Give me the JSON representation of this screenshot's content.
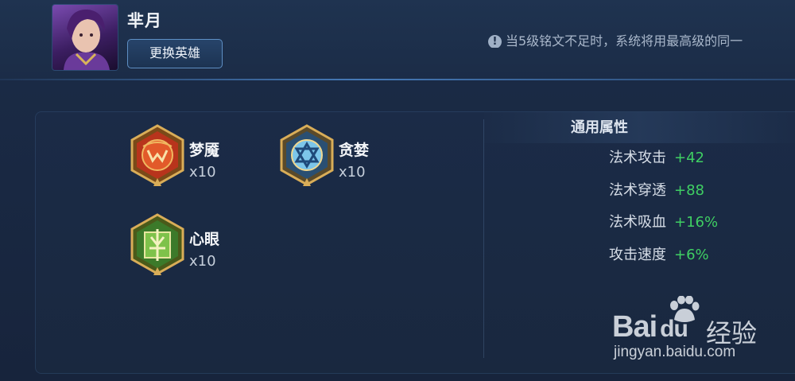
{
  "header": {
    "hero_name": "芈月",
    "change_hero_label": "更换英雄",
    "notice_text": "当5级铭文不足时，系统将用最高级的同一"
  },
  "runes": [
    {
      "name": "梦魇",
      "count": "x10",
      "color": "#d8452a"
    },
    {
      "name": "贪婪",
      "count": "x10",
      "color": "#5aa6d8"
    },
    {
      "name": "心眼",
      "count": "x10",
      "color": "#5fa83a"
    }
  ],
  "attributes": {
    "title": "通用属性",
    "items": [
      {
        "label": "法术攻击",
        "value": "+42"
      },
      {
        "label": "法术穿透",
        "value": "+88"
      },
      {
        "label": "法术吸血",
        "value": "+16%"
      },
      {
        "label": "攻击速度",
        "value": "+6%"
      }
    ]
  },
  "watermark": {
    "logo": "Bai",
    "logo_du": "du",
    "label": "经验",
    "url": "jingyan.baidu.com"
  },
  "colors": {
    "value_green": "#3fcf63",
    "gold_frame": "#c9a04c"
  }
}
